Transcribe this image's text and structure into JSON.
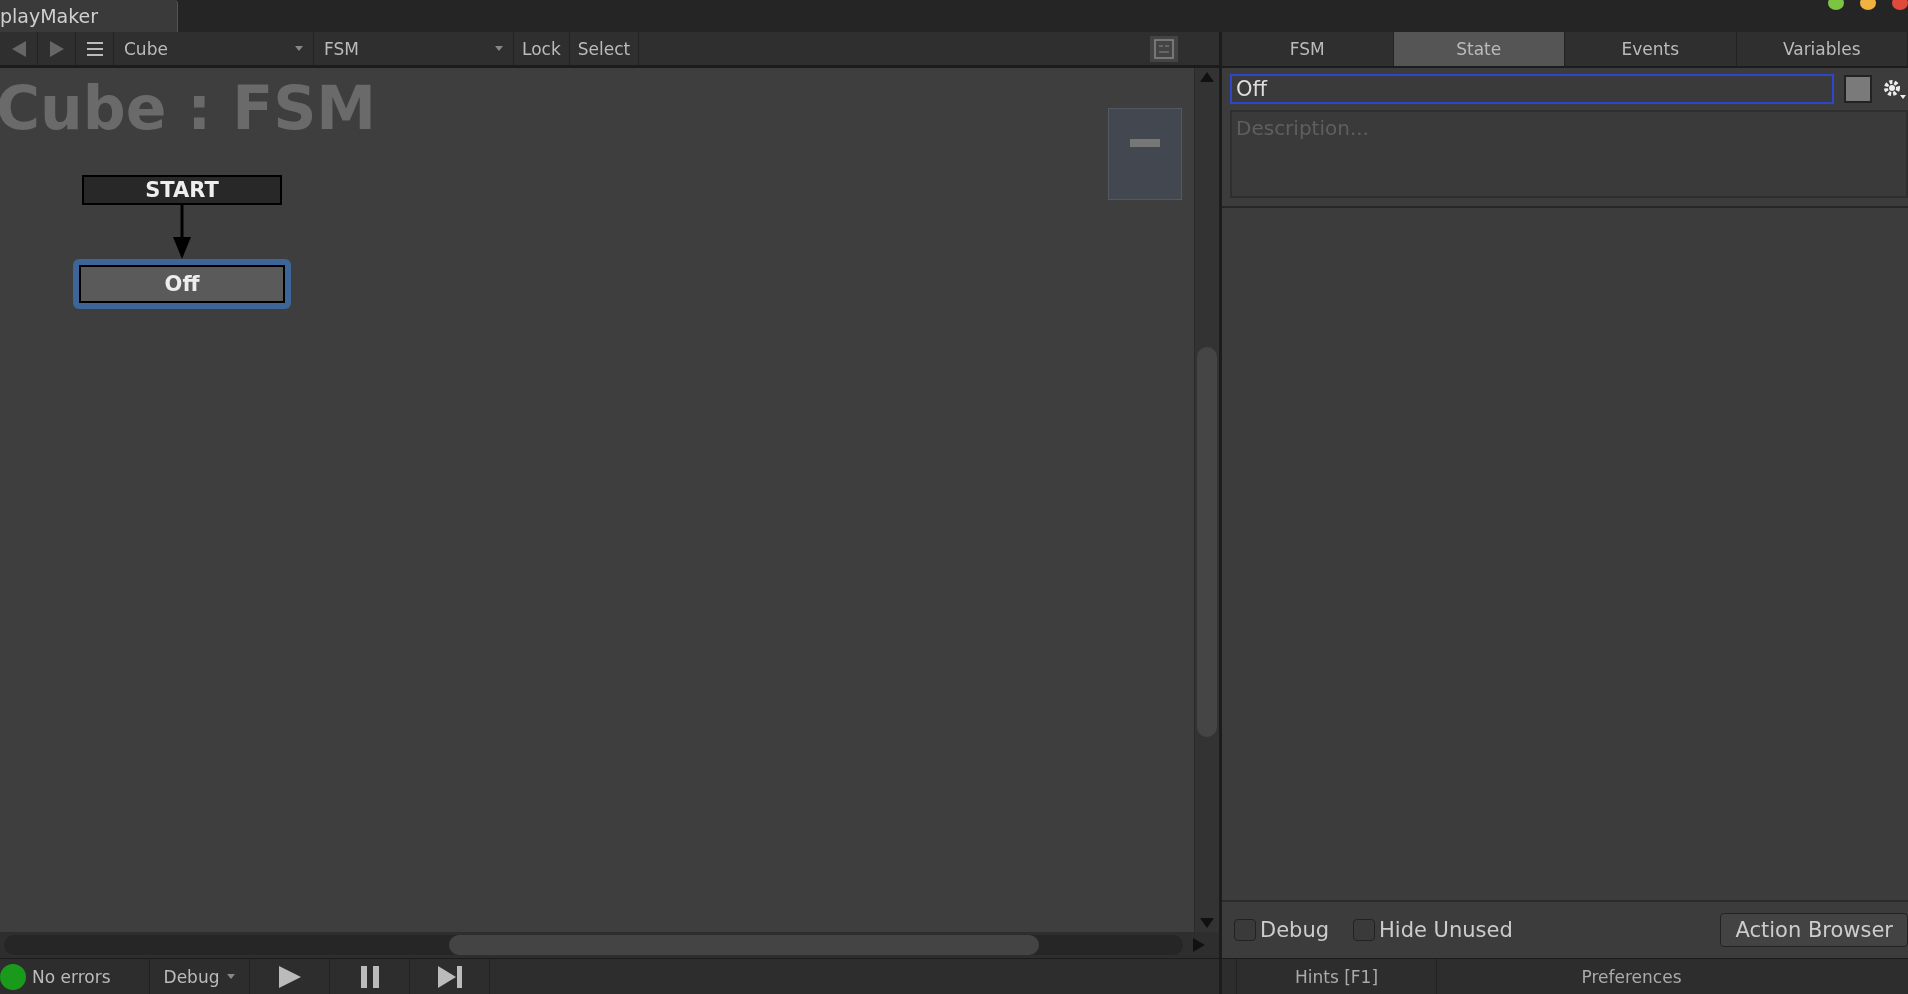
{
  "window": {
    "tab": "playMaker"
  },
  "toolbar": {
    "selectors": [
      {
        "label": "Cube"
      },
      {
        "label": "FSM"
      }
    ],
    "buttons": [
      "Lock",
      "Select"
    ]
  },
  "graph": {
    "title": "Cube : FSM",
    "nodes": [
      {
        "label": "START",
        "kind": "start",
        "selected": false
      },
      {
        "label": "Off",
        "kind": "state",
        "selected": true
      }
    ]
  },
  "inspector": {
    "tabs": [
      {
        "label": "FSM",
        "selected": false
      },
      {
        "label": "State",
        "selected": true
      },
      {
        "label": "Events",
        "selected": false
      },
      {
        "label": "Variables",
        "selected": false
      }
    ],
    "state_name": "Off",
    "description": {
      "placeholder": "Description..."
    },
    "options": [
      {
        "label": "Debug",
        "checked": false
      },
      {
        "label": "Hide Unused",
        "checked": false
      }
    ],
    "action_button": "Action Browser"
  },
  "status_bar": {
    "status": "No errors",
    "mode": "Debug",
    "links": [
      "Hints [F1]",
      "Preferences"
    ]
  }
}
